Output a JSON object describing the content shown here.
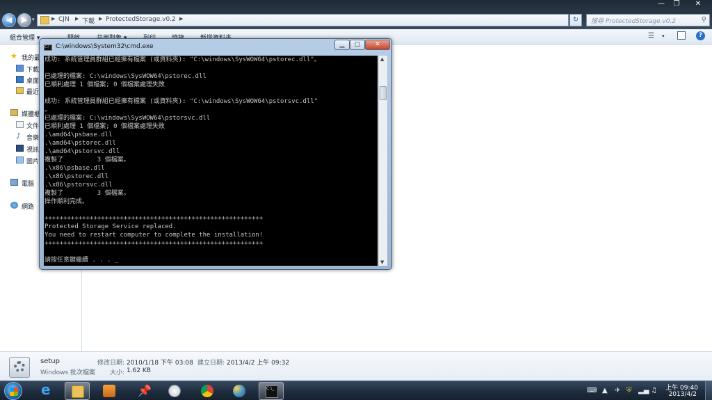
{
  "explorer": {
    "breadcrumbs": [
      "CJN",
      "下載",
      "ProtectedStorage.v0.2"
    ],
    "search_placeholder": "搜尋 ProtectedStorage.v0.2",
    "toolbar": {
      "organize": "組合管理 ▾",
      "open": "開啟",
      "share": "共用對象 ▾",
      "print": "列印",
      "burn": "燒錄",
      "new_folder": "新增資料夾"
    },
    "nav": [
      {
        "label": "我的最愛",
        "icon": "star-icon"
      },
      {
        "label": "下載",
        "icon": "folder-icon"
      },
      {
        "label": "桌面",
        "icon": "desktop-icon"
      },
      {
        "label": "最近",
        "icon": "recent-icon"
      },
      {
        "label": "媒體櫃",
        "icon": "library-icon"
      },
      {
        "label": "文件",
        "icon": "document-icon"
      },
      {
        "label": "音樂",
        "icon": "music-icon"
      },
      {
        "label": "視訊",
        "icon": "video-icon"
      },
      {
        "label": "圖片",
        "icon": "picture-icon"
      },
      {
        "label": "電腦",
        "icon": "computer-icon"
      },
      {
        "label": "網路",
        "icon": "network-icon"
      }
    ],
    "details": {
      "name": "setup",
      "type": "Windows 批次檔案",
      "modified_label": "修改日期:",
      "modified_value": "2010/1/18 下午 03:08",
      "created_label": "建立日期:",
      "created_value": "2013/4/2 上午 09:32",
      "size_label": "大小:",
      "size_value": "1.62 KB"
    }
  },
  "cmd": {
    "title": "C:\\windows\\System32\\cmd.exe",
    "lines": [
      "成功: 系統管理員群組已經擁有檔案 (或資料夾): \"C:\\windows\\SysWOW64\\pstorec.dll\"。",
      "",
      "已處理的檔案: C:\\windows\\SysWOW64\\pstorec.dll",
      "已順利處理 1 個檔案; 0 個檔案處理失敗",
      "",
      "成功: 系統管理員群組已經擁有檔案 (或資料夾): \"C:\\windows\\SysWOW64\\pstorsvc.dll\"",
      "。",
      "已處理的檔案: C:\\windows\\SysWOW64\\pstorsvc.dll",
      "已順利處理 1 個檔案; 0 個檔案處理失敗",
      ".\\amd64\\psbase.dll",
      ".\\amd64\\pstorec.dll",
      ".\\amd64\\pstorsvc.dll",
      "複製了         3 個檔案。",
      ".\\x86\\psbase.dll",
      ".\\x86\\pstorec.dll",
      ".\\x86\\pstorsvc.dll",
      "複製了         3 個檔案。",
      "操作順利完成。",
      "",
      "++++++++++++++++++++++++++++++++++++++++++++++++++++++++++",
      "Protected Storage Service replaced.",
      "You need to restart computer to complete the installation!",
      "++++++++++++++++++++++++++++++++++++++++++++++++++++++++++",
      "",
      "請按任意鍵繼續 . . . _"
    ]
  },
  "taskbar": {
    "apps": [
      "internet-explorer-icon",
      "explorer-icon",
      "media-player-icon",
      "pin-icon",
      "clock-app-icon",
      "chrome-icon",
      "paint-icon",
      "cmd-icon"
    ],
    "clock_time": "上午 09:40",
    "clock_date": "2013/4/2"
  },
  "colors": {
    "console_bg": "#000000",
    "console_fg": "#c6c6c6",
    "taskbar": "#1d2b3b"
  }
}
